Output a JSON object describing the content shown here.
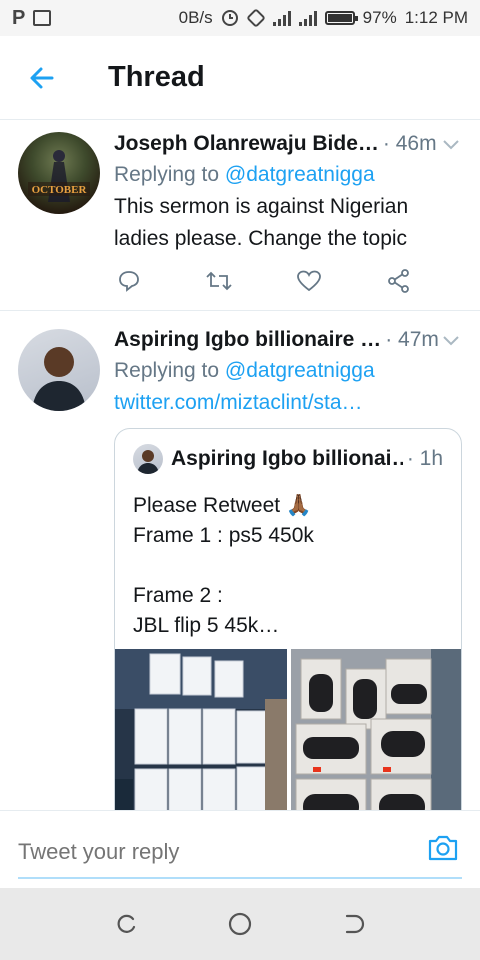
{
  "status_bar": {
    "speed": "0B/s",
    "battery": "97%",
    "time": "1:12 PM",
    "battery_level": 0.97
  },
  "header": {
    "title": "Thread",
    "back_icon": "arrow-left-icon",
    "accent_color": "#1da1f2"
  },
  "tweets": [
    {
      "name": "Joseph Olanrewaju Bide…",
      "time": "· 46m",
      "replying_prefix": "Replying to",
      "replying_to": "@datgreatnigga",
      "text": "This sermon is against Nigerian ladies please. Change the topic",
      "avatar_text": "OCTOBER"
    },
    {
      "name": "Aspiring Igbo billionaire …",
      "time": "· 47m",
      "replying_prefix": "Replying to",
      "replying_to": "@datgreatnigga",
      "link": "twitter.com/miztaclint/sta…",
      "quote": {
        "name": "Aspiring Igbo billionai…",
        "time": "· 1h",
        "text": "Please Retweet 🙏🏾\nFrame 1 : ps5  450k\n\nFrame 2 :\nJBL flip 5 45k…"
      }
    }
  ],
  "reply": {
    "placeholder": "Tweet your reply"
  }
}
